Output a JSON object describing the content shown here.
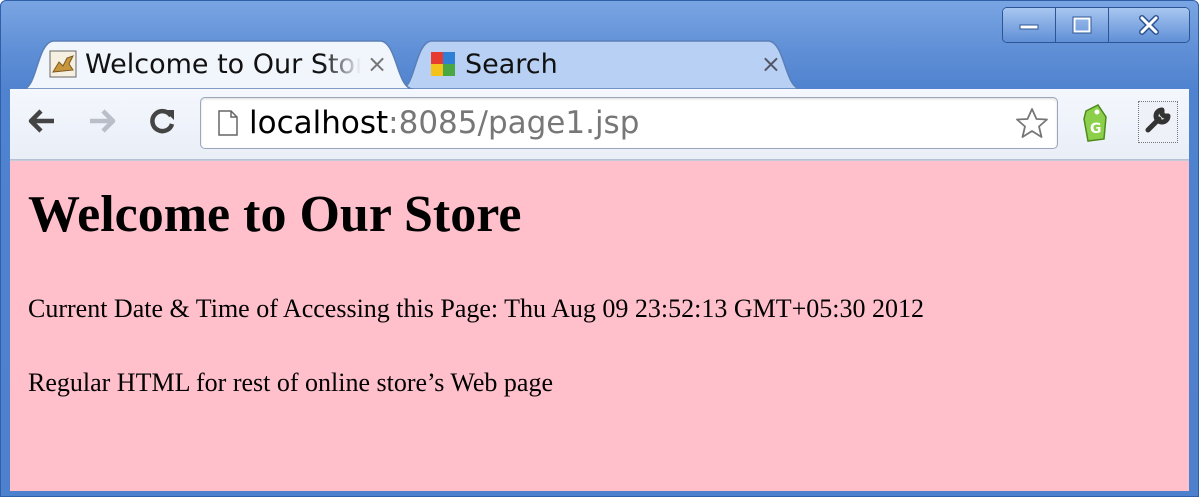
{
  "window": {
    "controls": {
      "minimize_icon": "minimize-icon",
      "maximize_icon": "maximize-icon",
      "close_icon": "close-icon"
    }
  },
  "tabs": [
    {
      "title": "Welcome to Our Store",
      "close": "×",
      "active": true,
      "favicon": "tomcat-icon"
    },
    {
      "title": "Search",
      "close": "×",
      "active": false,
      "favicon": "avg-search-icon"
    }
  ],
  "toolbar": {
    "back_icon": "back-arrow-icon",
    "forward_icon": "forward-arrow-icon",
    "reload_icon": "reload-icon",
    "url_host": "localhost",
    "url_rest": ":8085/page1.jsp",
    "bookmark_icon": "star-icon",
    "extension_icon": "price-tag-icon",
    "menu_icon": "wrench-icon"
  },
  "page": {
    "heading": "Welcome to Our Store",
    "datetime_line": "Current Date & Time of Accessing this Page: Thu Aug 09 23:52:13 GMT+05:30 2012",
    "body_line": "Regular HTML for rest of online store’s Web page",
    "background": "#ffc0cb"
  },
  "colors": {
    "frame": "#4f82cf",
    "page_bg": "#ffc0cb"
  }
}
